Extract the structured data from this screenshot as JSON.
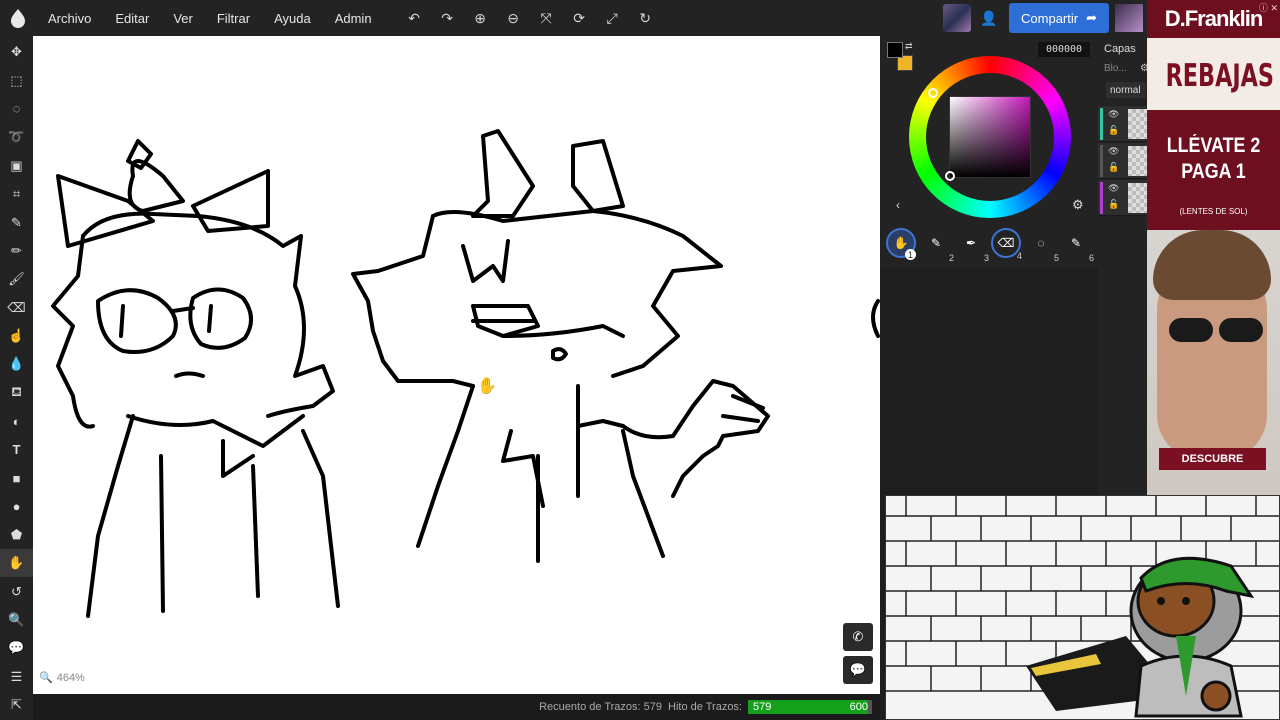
{
  "menu": {
    "items": [
      "Archivo",
      "Editar",
      "Ver",
      "Filtrar",
      "Ayuda",
      "Admin"
    ]
  },
  "toolbar_icons": [
    "undo-icon",
    "redo-icon",
    "zoom-in-icon",
    "zoom-out-icon",
    "fit-screen-icon",
    "rotate-icon",
    "fullscreen-icon",
    "reset-rotation-icon"
  ],
  "share": {
    "label": "Compartir"
  },
  "left_tools": [
    "move",
    "rect-select",
    "ellipse-select",
    "lasso-select",
    "transform",
    "crop",
    "eyedropper",
    "pencil",
    "brush",
    "eraser",
    "smudge",
    "blur",
    "fill",
    "gradient",
    "text",
    "rectangle",
    "ellipse",
    "polygon",
    "hand",
    "rotate-view",
    "zoom",
    "comment",
    "layers-toggle",
    "export"
  ],
  "canvas": {
    "zoom_label": "464%"
  },
  "status": {
    "stroke_count_label": "Recuento de Trazos: 579",
    "stroke_milestone_label": "Hito de Trazos:",
    "stroke_current": "579",
    "stroke_max": "600",
    "stroke_progress": 0.965
  },
  "color": {
    "hex": "000000",
    "primary": "#000000",
    "secondary": "#f0b429",
    "hue_color": "#c218b8"
  },
  "brush_slots": [
    "1",
    "2",
    "3",
    "4",
    "5",
    "6"
  ],
  "layers": {
    "title": "Capas",
    "blend_label": "Blo...",
    "mode": "normal",
    "items": [
      {
        "strip_color": "#35c7a3"
      },
      {
        "strip_color": "#555555"
      },
      {
        "strip_color": "#b13fd4"
      }
    ]
  },
  "ad": {
    "brand": "D.Franklin",
    "sale": "REBAJAS",
    "promo_line1": "LLÉVATE 2",
    "promo_line2": "PAGA 1",
    "note": "(LENTES DE SOL)",
    "cta": "DESCUBRE"
  }
}
